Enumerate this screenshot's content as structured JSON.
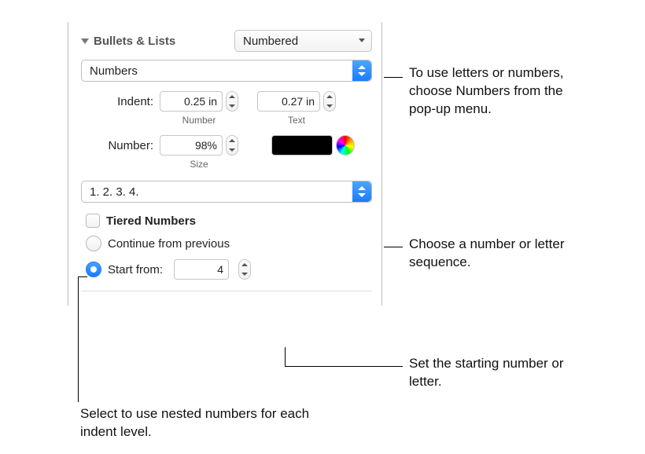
{
  "header": {
    "title": "Bullets & Lists",
    "style_popup": "Numbered"
  },
  "type_popup": "Numbers",
  "indent": {
    "label": "Indent:",
    "number_value": "0.25 in",
    "text_value": "0.27 in",
    "number_sublabel": "Number",
    "text_sublabel": "Text"
  },
  "number": {
    "label": "Number:",
    "size_value": "98%",
    "size_sublabel": "Size"
  },
  "sequence_popup": "1. 2. 3. 4.",
  "tiered": {
    "label": "Tiered Numbers"
  },
  "continuation": {
    "continue_label": "Continue from previous",
    "start_label": "Start from:",
    "start_value": "4"
  },
  "annotations": {
    "numbers_popup": "To use letters or numbers, choose Numbers from the pop-up menu.",
    "sequence": "Choose a number or letter sequence.",
    "start": "Set the starting number or letter.",
    "tiered": "Select to use nested numbers for each indent level."
  }
}
